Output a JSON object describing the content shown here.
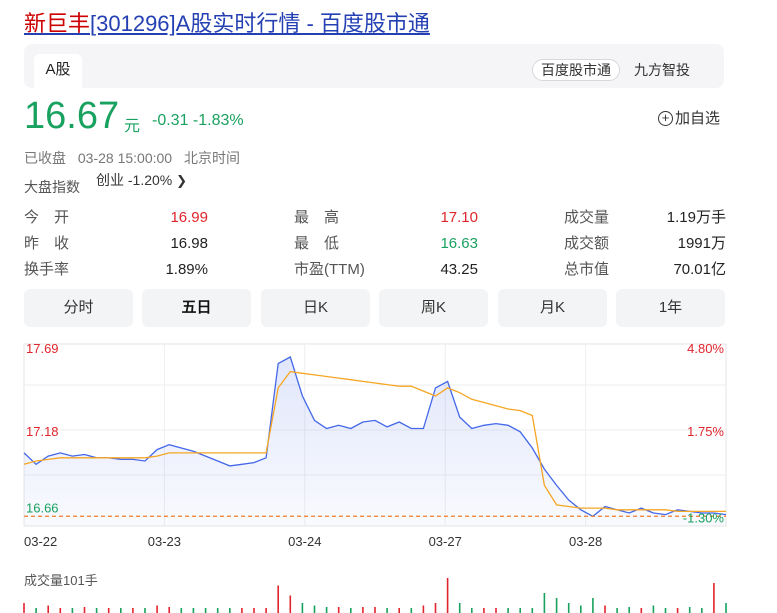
{
  "header": {
    "stock_name": "新巨丰",
    "rest_title": "[301296]A股实时行情 - 百度股市通"
  },
  "market_tab": {
    "label": "A股"
  },
  "sources": [
    "百度股市通",
    "九方智投"
  ],
  "quote": {
    "price": "16.67",
    "unit": "元",
    "change": "-0.31",
    "change_pct": "-1.83%",
    "add_watch": "加自选"
  },
  "status": {
    "state": "已收盘",
    "time": "03-28 15:00:00",
    "zone": "北京时间"
  },
  "market_index": {
    "label": "大盘指数",
    "value": "创业 -1.20%"
  },
  "stats": {
    "open": {
      "label": "今　开",
      "value": "16.99"
    },
    "high": {
      "label": "最　高",
      "value": "17.10"
    },
    "volume": {
      "label": "成交量",
      "value": "1.19万手"
    },
    "prev_close": {
      "label": "昨　收",
      "value": "16.98"
    },
    "low": {
      "label": "最　低",
      "value": "16.63"
    },
    "turnover": {
      "label": "成交额",
      "value": "1991万"
    },
    "turnover_rate": {
      "label": "换手率",
      "value": "1.89%"
    },
    "pe_ttm": {
      "label": "市盈(TTM)",
      "value": "43.25"
    },
    "market_cap": {
      "label": "总市值",
      "value": "70.01亿"
    }
  },
  "periods": [
    "分时",
    "五日",
    "日K",
    "周K",
    "月K",
    "1年"
  ],
  "active_period": "五日",
  "chart_data": {
    "type": "line",
    "y_left_ticks": [
      "17.69",
      "17.18",
      "16.66"
    ],
    "y_right_ticks": [
      "4.80%",
      "1.75%",
      "-1.30%"
    ],
    "x_ticks": [
      "03-22",
      "03-23",
      "03-24",
      "03-27",
      "03-28"
    ],
    "baseline": 16.66,
    "ylim": [
      16.6,
      17.72
    ],
    "series": [
      {
        "color": "#4468e8",
        "values": [
          17.05,
          16.98,
          17.03,
          17.05,
          17.03,
          17.04,
          17.02,
          17.02,
          17.01,
          17.01,
          17.0,
          17.07,
          17.1,
          17.08,
          17.06,
          17.03,
          17.0,
          16.97,
          16.98,
          16.99,
          17.02,
          17.6,
          17.64,
          17.4,
          17.25,
          17.2,
          17.22,
          17.2,
          17.24,
          17.25,
          17.21,
          17.24,
          17.2,
          17.2,
          17.45,
          17.49,
          17.27,
          17.2,
          17.22,
          17.23,
          17.22,
          17.18,
          17.08,
          16.95,
          16.85,
          16.76,
          16.7,
          16.66,
          16.72,
          16.7,
          16.68,
          16.71,
          16.68,
          16.67,
          16.7,
          16.69,
          16.68,
          16.68,
          16.67
        ]
      },
      {
        "color": "#f5a623",
        "values": [
          16.98,
          17.0,
          17.01,
          17.02,
          17.02,
          17.02,
          17.02,
          17.02,
          17.02,
          17.02,
          17.02,
          17.03,
          17.05,
          17.05,
          17.05,
          17.05,
          17.05,
          17.05,
          17.05,
          17.05,
          17.05,
          17.45,
          17.55,
          17.54,
          17.53,
          17.52,
          17.51,
          17.5,
          17.49,
          17.48,
          17.47,
          17.46,
          17.46,
          17.43,
          17.4,
          17.45,
          17.42,
          17.38,
          17.36,
          17.34,
          17.32,
          17.31,
          17.28,
          16.85,
          16.73,
          16.72,
          16.71,
          16.71,
          16.71,
          16.7,
          16.7,
          16.7,
          16.7,
          16.7,
          16.69,
          16.69,
          16.69,
          16.69,
          16.69
        ]
      }
    ]
  },
  "volume": {
    "label": "成交量101手",
    "values": [
      0.2,
      0.1,
      0.15,
      0.1,
      0.1,
      0.12,
      0.1,
      0.1,
      0.1,
      0.1,
      0.1,
      0.15,
      0.12,
      0.1,
      0.1,
      0.1,
      0.1,
      0.1,
      0.1,
      0.1,
      0.1,
      0.55,
      0.35,
      0.2,
      0.15,
      0.12,
      0.12,
      0.1,
      0.12,
      0.12,
      0.1,
      0.1,
      0.1,
      0.15,
      0.2,
      0.7,
      0.2,
      0.1,
      0.1,
      0.1,
      0.1,
      0.1,
      0.1,
      0.4,
      0.3,
      0.2,
      0.15,
      0.3,
      0.15,
      0.1,
      0.12,
      0.1,
      0.15,
      0.1,
      0.1,
      0.12,
      0.1,
      0.6,
      0.2
    ]
  }
}
